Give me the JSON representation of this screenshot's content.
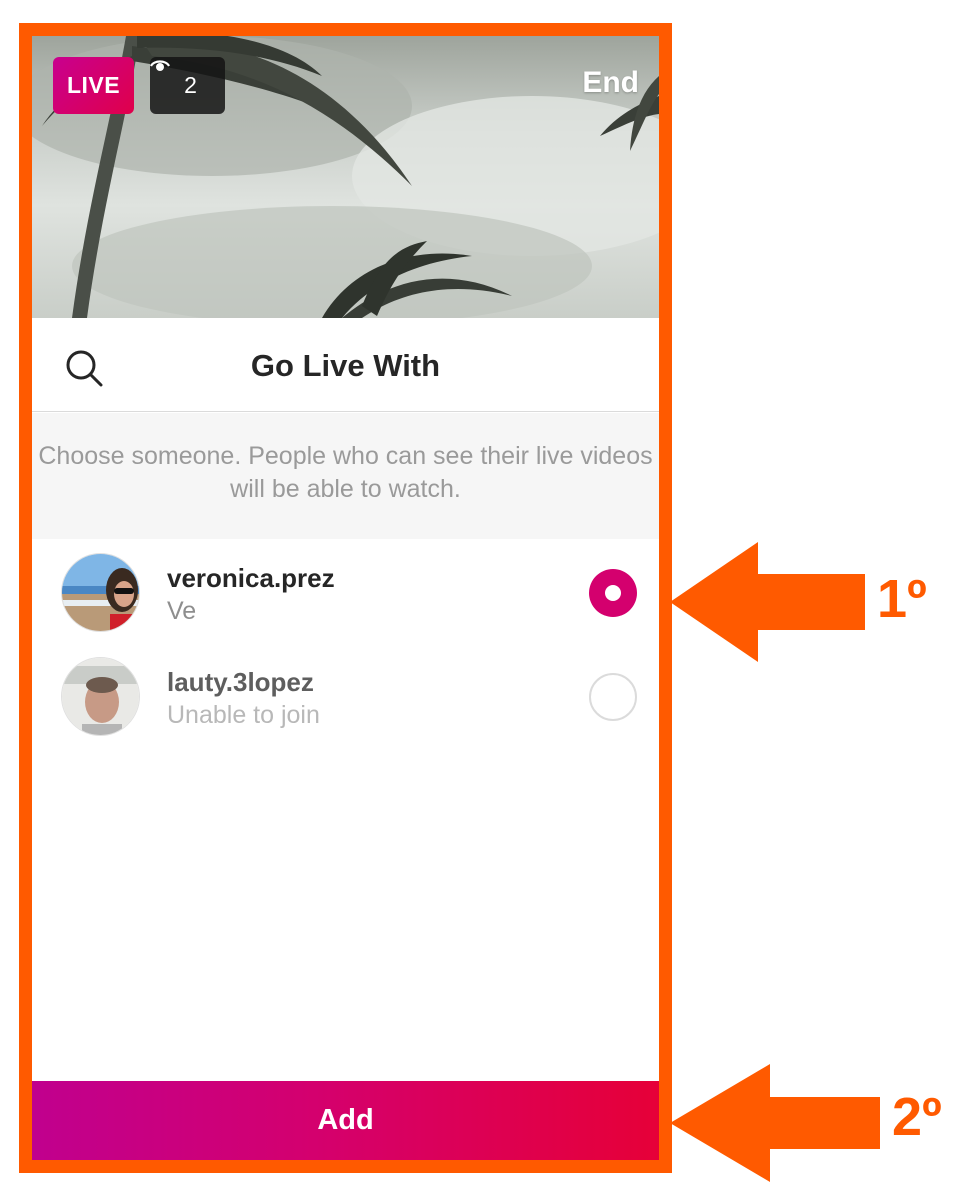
{
  "camera": {
    "live_label": "LIVE",
    "viewer_count": "2",
    "end_label": "End"
  },
  "sheet": {
    "title": "Go Live With",
    "info_text": "Choose someone. People who can see their live videos will be able to watch."
  },
  "users": [
    {
      "username": "veronica.prez",
      "subtitle": "Ve",
      "selected": true,
      "enabled": true
    },
    {
      "username": "lauty.3lopez",
      "subtitle": "Unable to join",
      "selected": false,
      "enabled": false
    }
  ],
  "add_button": {
    "label": "Add"
  },
  "annotations": {
    "step1": "1º",
    "step2": "2º"
  },
  "colors": {
    "frame": "#ff5a00",
    "accent": "#d4006e",
    "gradient_start": "#c0008e",
    "gradient_end": "#e60038"
  }
}
